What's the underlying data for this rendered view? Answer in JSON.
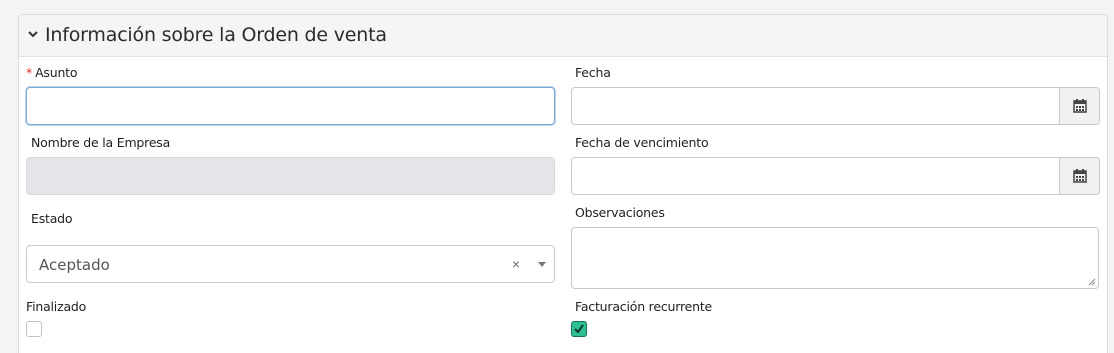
{
  "section": {
    "title": "Información sobre la Orden de venta"
  },
  "fields": {
    "subject": {
      "label": "Asunto",
      "required_mark": "*",
      "value": ""
    },
    "date": {
      "label": "Fecha",
      "value": ""
    },
    "company": {
      "label": "Nombre de la Empresa",
      "value": ""
    },
    "due_date": {
      "label": "Fecha de vencimiento",
      "value": ""
    },
    "status": {
      "label": "Estado",
      "value": "Aceptado",
      "clear": "×"
    },
    "notes": {
      "label": "Observaciones",
      "value": ""
    },
    "finished": {
      "label": "Finalizado",
      "checked": false
    },
    "recurring": {
      "label": "Facturación recurrente",
      "checked": true
    }
  },
  "colors": {
    "checkbox_checked": "#2fbf94",
    "focus_border": "#7fa9d3",
    "required": "#d9302c"
  },
  "icons": [
    "chevron-down-icon",
    "calendar-icon",
    "caret-down-icon",
    "resize-handle-icon",
    "check-icon"
  ]
}
